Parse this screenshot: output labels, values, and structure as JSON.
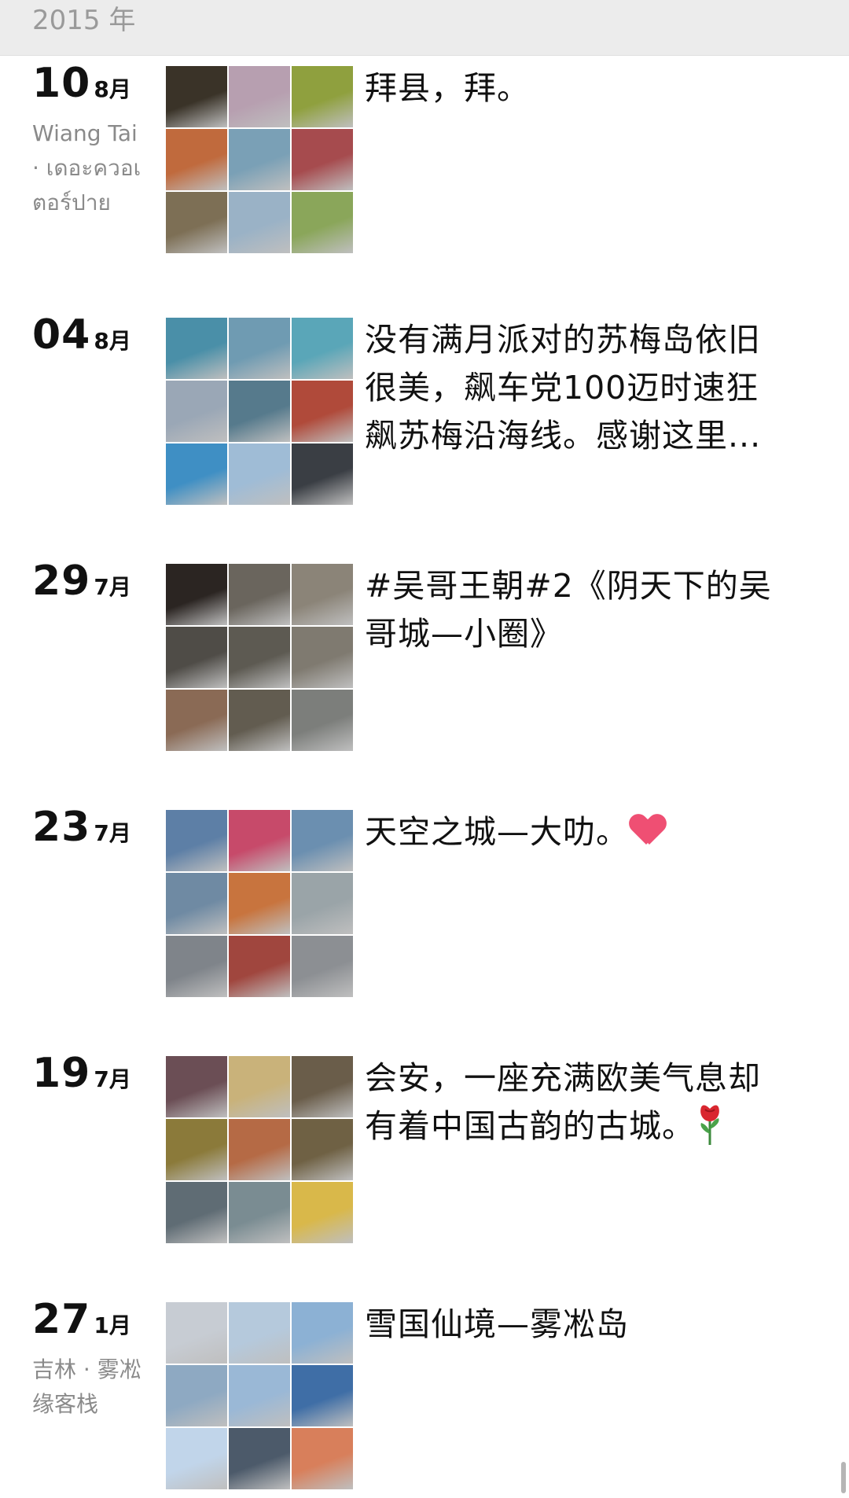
{
  "year_header": "2015 年",
  "posts": [
    {
      "day": "10",
      "month": "8月",
      "location": "Wiang Tai · เดอะควอเตอร์ปาย",
      "text": "拜县，拜。",
      "emoji": "",
      "colors": [
        "#3a3328",
        "#b79fb0",
        "#8fa03e",
        "#c06a3d",
        "#7aa0b6",
        "#a64b4e",
        "#7d6f55",
        "#9ab2c6",
        "#8aa65a"
      ]
    },
    {
      "day": "04",
      "month": "8月",
      "location": "",
      "text": "没有满月派对的苏梅岛依旧很美，飙车党100迈时速狂飙苏梅沿海线。感谢这里...",
      "emoji": "",
      "colors": [
        "#4a8fa8",
        "#6f9bb2",
        "#5aa6b8",
        "#9aa7b6",
        "#567a8c",
        "#b04a3a",
        "#3f8fc4",
        "#9fbcd6",
        "#3a3e44"
      ]
    },
    {
      "day": "29",
      "month": "7月",
      "location": "",
      "text": "#吴哥王朝#2《阴天下的吴哥城—小圈》",
      "emoji": "",
      "colors": [
        "#2b2522",
        "#6a655d",
        "#8b8478",
        "#4f4c47",
        "#5d5a52",
        "#7f7a70",
        "#8a6a55",
        "#625c50",
        "#7c7e7b"
      ]
    },
    {
      "day": "23",
      "month": "7月",
      "location": "",
      "text": "天空之城—大叻。",
      "emoji": "heart",
      "colors": [
        "#5d7fa6",
        "#c74a6a",
        "#6b8fb0",
        "#6f8aa3",
        "#c8743e",
        "#9aa4a8",
        "#7f848a",
        "#a0463e",
        "#8c8f93"
      ]
    },
    {
      "day": "19",
      "month": "7月",
      "location": "",
      "text": "会安，一座充满欧美气息却有着中国古韵的古城。",
      "emoji": "rose",
      "colors": [
        "#6b4e55",
        "#c9b27a",
        "#6a5d4a",
        "#8b7a3a",
        "#b56a45",
        "#6f6144",
        "#5f6c74",
        "#7a8c92",
        "#d9b84a"
      ]
    },
    {
      "day": "27",
      "month": "1月",
      "location": "吉林 · 雾凇缘客栈",
      "text": "雪国仙境—雾凇岛",
      "emoji": "",
      "colors": [
        "#c7ccd3",
        "#b5c9dc",
        "#8cb1d4",
        "#8ea9c2",
        "#9ab8d6",
        "#3f6ea6",
        "#c1d5ea",
        "#4c5a6a",
        "#d87f5b"
      ]
    }
  ]
}
